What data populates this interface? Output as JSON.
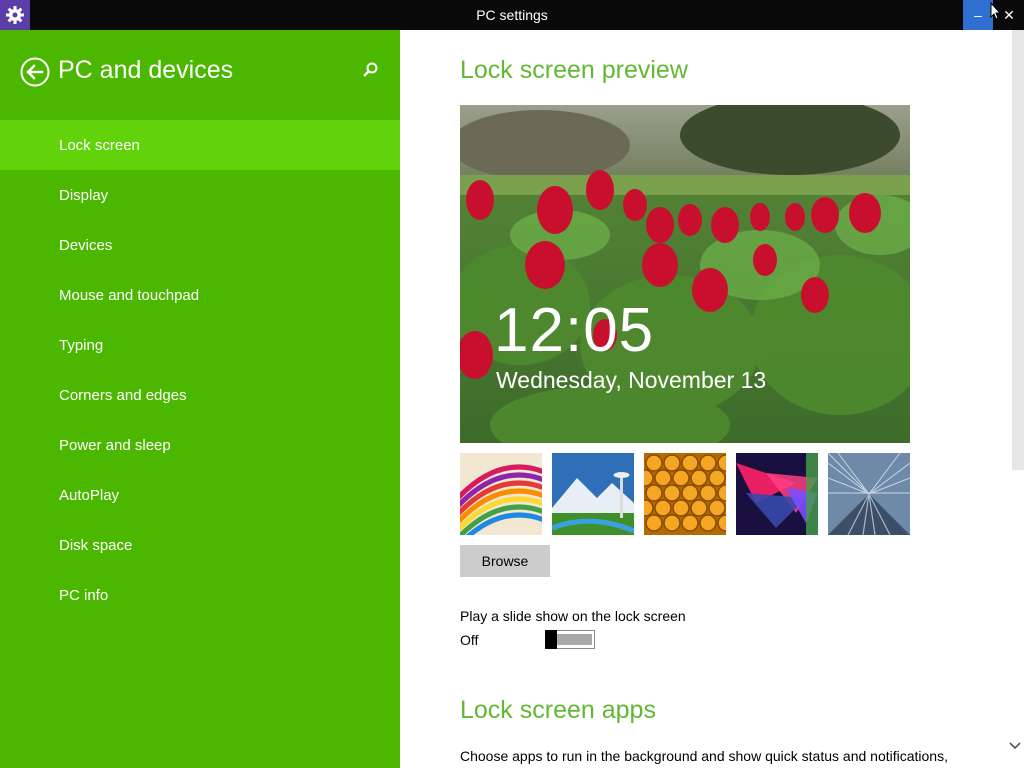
{
  "window": {
    "title": "PC settings",
    "minimize_glyph": "–",
    "close_glyph": "✕",
    "icon": "gear-icon"
  },
  "sidebar": {
    "title": "PC and devices",
    "back_icon": "back-arrow-icon",
    "search_icon": "search-icon",
    "accent_color": "#4cb700",
    "active_color": "#62d20a",
    "items": [
      {
        "label": "Lock screen",
        "active": true
      },
      {
        "label": "Display"
      },
      {
        "label": "Devices"
      },
      {
        "label": "Mouse and touchpad"
      },
      {
        "label": "Typing"
      },
      {
        "label": "Corners and edges"
      },
      {
        "label": "Power and sleep"
      },
      {
        "label": "AutoPlay"
      },
      {
        "label": "Disk space"
      },
      {
        "label": "PC info"
      }
    ]
  },
  "main": {
    "heading_color": "#62b832",
    "lock_screen_preview": {
      "heading": "Lock screen preview",
      "time": "12:05",
      "date": "Wednesday, November 13"
    },
    "thumbnails": [
      "colorful-stripes",
      "space-needle",
      "honeycomb",
      "abstract-shapes",
      "railway-tunnel"
    ],
    "browse_label": "Browse",
    "slideshow": {
      "label": "Play a slide show on the lock screen",
      "state": "Off"
    },
    "lock_screen_apps": {
      "heading": "Lock screen apps",
      "description": "Choose apps to run in the background and show quick status and notifications,"
    }
  }
}
